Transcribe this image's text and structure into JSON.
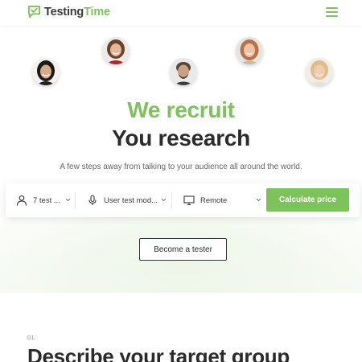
{
  "header": {
    "logo_text_primary": "Testing",
    "logo_text_accent": "Time",
    "menu_icon": "hamburger-menu-icon"
  },
  "colors": {
    "brand_green": "#7cc35b",
    "text_dark": "#2b2b2b"
  },
  "hero": {
    "headline_primary": "We recruit",
    "headline_secondary": "You research",
    "subtitle": "A few steps away from talking to your audience all around the world."
  },
  "search": {
    "fields": [
      {
        "icon": "person-icon",
        "label": "7 test ..."
      },
      {
        "icon": "microphone-icon",
        "label": "User test mod..."
      },
      {
        "icon": "monitor-icon",
        "label": "Remote"
      }
    ],
    "submit_label": "Calculate price"
  },
  "cta": {
    "tester_label": "Become a tester"
  },
  "section": {
    "step": "01.",
    "title": "Describe your target group"
  }
}
